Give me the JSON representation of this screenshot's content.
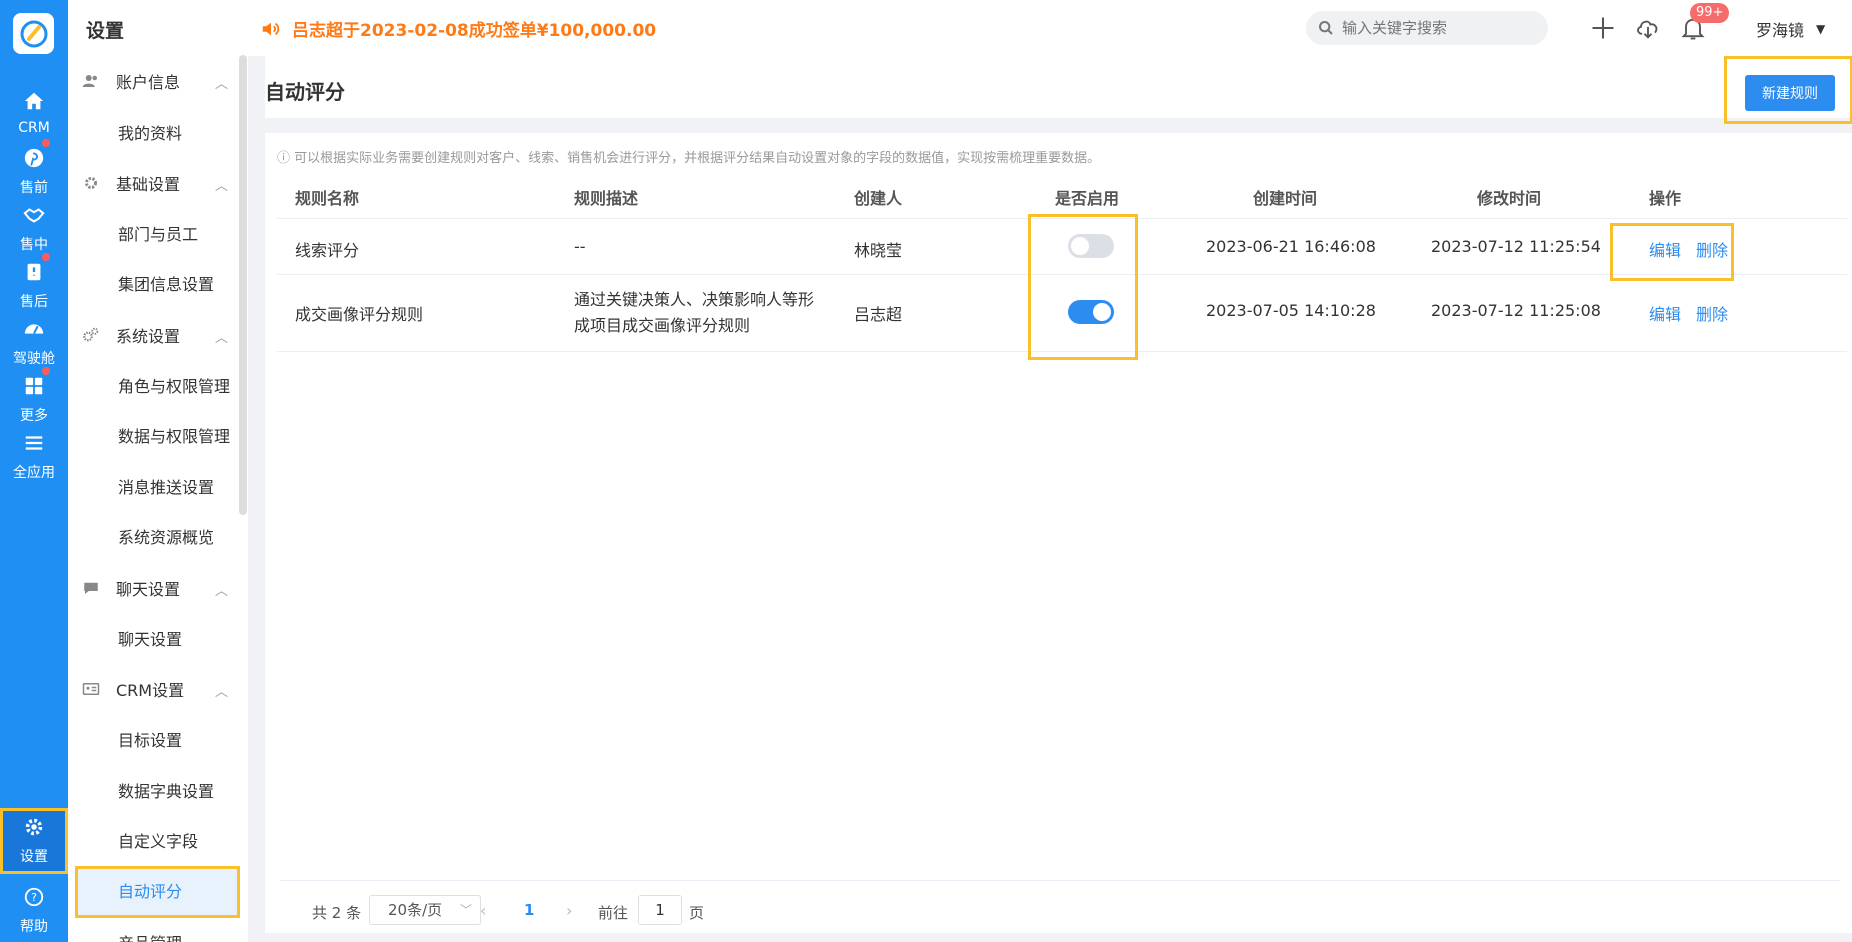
{
  "rail": {
    "items": [
      {
        "label": "CRM",
        "icon": "home-icon"
      },
      {
        "label": "售前",
        "icon": "pinterest-icon",
        "dot": true
      },
      {
        "label": "售中",
        "icon": "handshake-icon"
      },
      {
        "label": "售后",
        "icon": "clipboard-icon",
        "dot": true
      },
      {
        "label": "驾驶舱",
        "icon": "dashboard-icon"
      },
      {
        "label": "更多",
        "icon": "grid-icon",
        "dot": true
      },
      {
        "label": "全应用",
        "icon": "menu-icon"
      },
      {
        "label": "设置",
        "icon": "gear-icon"
      },
      {
        "label": "帮助",
        "icon": "help-icon"
      }
    ]
  },
  "submenu": {
    "title": "设置",
    "groups": [
      {
        "label": "账户信息",
        "items": [
          "我的资料"
        ]
      },
      {
        "label": "基础设置",
        "items": [
          "部门与员工",
          "集团信息设置"
        ]
      },
      {
        "label": "系统设置",
        "items": [
          "角色与权限管理",
          "数据与权限管理",
          "消息推送设置",
          "系统资源概览"
        ]
      },
      {
        "label": "聊天设置",
        "items": [
          "聊天设置"
        ]
      },
      {
        "label": "CRM设置",
        "items": [
          "目标设置",
          "数据字典设置",
          "自定义字段",
          "自动评分",
          "产品管理"
        ]
      }
    ]
  },
  "topbar": {
    "notice": "吕志超于2023-02-08成功签单¥100,000.00",
    "search_placeholder": "输入关键字搜索",
    "badge": "99+",
    "user": "罗海镜"
  },
  "page": {
    "title": "自动评分",
    "new_button": "新建规则",
    "tip": "ⓘ 可以根据实际业务需要创建规则对客户、线索、销售机会进行评分，并根据评分结果自动设置对象的字段的数据值，实现按需梳理重要数据。"
  },
  "table": {
    "headers": [
      "规则名称",
      "规则描述",
      "创建人",
      "是否启用",
      "创建时间",
      "修改时间",
      "操作"
    ],
    "rows": [
      {
        "name": "线索评分",
        "desc": "--",
        "creator": "林晓莹",
        "enabled": false,
        "created": "2023-06-21 16:46:08",
        "modified": "2023-07-12 11:25:54",
        "edit": "编辑",
        "delete": "删除"
      },
      {
        "name": "成交画像评分规则",
        "desc": "通过关键决策人、决策影响人等形成项目成交画像评分规则",
        "creator": "吕志超",
        "enabled": true,
        "created": "2023-07-05 14:10:28",
        "modified": "2023-07-12 11:25:08",
        "edit": "编辑",
        "delete": "删除"
      }
    ]
  },
  "pager": {
    "total": "共 2 条",
    "page_size": "20条/页",
    "current": "1",
    "goto_label": "前往",
    "goto_value": "1",
    "page_label": "页"
  }
}
